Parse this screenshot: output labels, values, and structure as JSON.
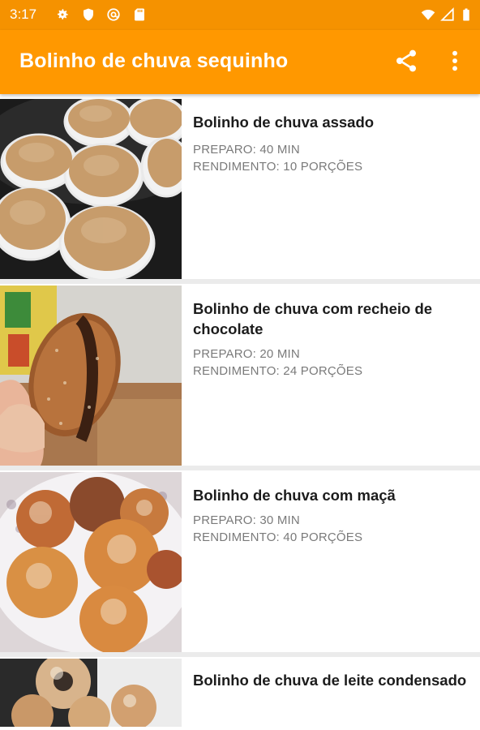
{
  "status_bar": {
    "time": "3:17",
    "left_icons": [
      "gear-icon",
      "shield-icon",
      "at-sign-icon",
      "sd-card-icon"
    ],
    "right_icons": [
      "wifi-icon",
      "signal-icon",
      "battery-icon"
    ]
  },
  "app_bar": {
    "title": "Bolinho de chuva sequinho",
    "actions": [
      "share-icon",
      "more-vert-icon"
    ],
    "color": "#ff9800"
  },
  "recipes": [
    {
      "title": "Bolinho de chuva assado",
      "preparo": "PREPARO: 40 MIN",
      "rendimento": "RENDIMENTO: 10 PORÇÕES"
    },
    {
      "title": "Bolinho de chuva com recheio de chocolate",
      "preparo": "PREPARO: 20 MIN",
      "rendimento": "RENDIMENTO: 24 PORÇÕES"
    },
    {
      "title": "Bolinho de chuva com maçã",
      "preparo": "PREPARO: 30 MIN",
      "rendimento": "RENDIMENTO: 40 PORÇÕES"
    },
    {
      "title": "Bolinho de chuva de leite condensado",
      "preparo": "",
      "rendimento": ""
    }
  ]
}
